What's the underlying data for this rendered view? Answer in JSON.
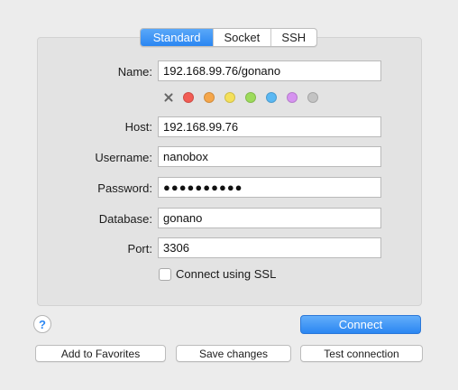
{
  "tabs": [
    {
      "label": "Standard",
      "active": true
    },
    {
      "label": "Socket",
      "active": false
    },
    {
      "label": "SSH",
      "active": false
    }
  ],
  "form": {
    "name_label": "Name:",
    "name_value": "192.168.99.76/gonano",
    "host_label": "Host:",
    "host_value": "192.168.99.76",
    "username_label": "Username:",
    "username_value": "nanobox",
    "password_label": "Password:",
    "password_value": "●●●●●●●●●●",
    "database_label": "Database:",
    "database_value": "gonano",
    "port_label": "Port:",
    "port_value": "3306",
    "ssl_label": "Connect using SSL",
    "ssl_checked": false
  },
  "color_tags": [
    {
      "name": "red",
      "color": "#f25c54"
    },
    {
      "name": "orange",
      "color": "#f5a64a"
    },
    {
      "name": "yellow",
      "color": "#f4e05a"
    },
    {
      "name": "green",
      "color": "#9ddb5b"
    },
    {
      "name": "blue",
      "color": "#5ab8f3"
    },
    {
      "name": "purple",
      "color": "#d693f0"
    },
    {
      "name": "gray",
      "color": "#c3c3c3"
    }
  ],
  "buttons": {
    "help": "?",
    "connect": "Connect",
    "add_favorites": "Add to Favorites",
    "save_changes": "Save changes",
    "test_connection": "Test connection"
  },
  "colors": {
    "accent": "#2a86f2",
    "panel": "#e3e3e3",
    "background": "#ececec"
  }
}
